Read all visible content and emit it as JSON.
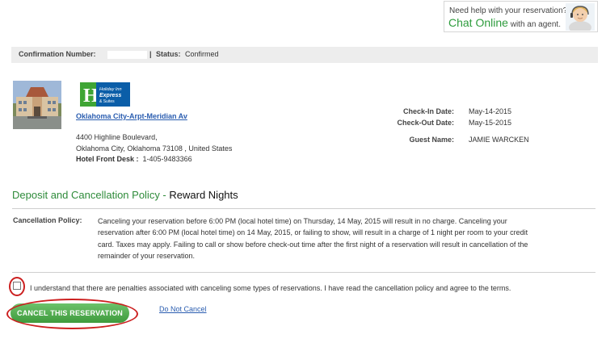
{
  "chat": {
    "line1": "Need help with your reservation?",
    "big": "Chat Online",
    "small": " with an agent.",
    "avatar_icon": "support-agent-avatar-icon"
  },
  "confirmation": {
    "number_label": "Confirmation Number:",
    "number_value": "",
    "status_label": "Status:",
    "status_value": "Confirmed"
  },
  "hotel": {
    "name_link": "Oklahoma City-Arpt-Meridian Av",
    "address1": "4400 Highline Boulevard,",
    "address2": "Oklahoma City, Oklahoma  73108 , United States",
    "front_desk_label": "Hotel Front Desk :",
    "front_desk_phone": "1-405-9483366",
    "logo_text": [
      "Holiday Inn",
      "Express",
      "& Suites"
    ]
  },
  "stay": {
    "check_in_label": "Check-In Date:",
    "check_in_value": "May-14-2015",
    "check_out_label": "Check-Out Date:",
    "check_out_value": "May-15-2015",
    "guest_label": "Guest Name:",
    "guest_value": "JAMIE WARCKEN"
  },
  "policy": {
    "title": "Deposit and Cancellation Policy - ",
    "title_suffix": " Reward Nights",
    "label": "Cancellation Policy:",
    "text": "Canceling your reservation before 6:00 PM (local hotel time) on Thursday, 14 May, 2015 will result in no charge. Canceling your reservation after 6:00 PM (local hotel time) on 14 May, 2015, or failing to show, will result in a charge of 1 night per room to your credit card. Taxes may apply. Failing to call or show before check-out time after the first night of a reservation will result in cancellation of the remainder of your reservation."
  },
  "agree": {
    "text": "I understand that there are penalties associated with canceling some types of reservations. I have read the cancellation policy and agree to the terms."
  },
  "actions": {
    "cancel_label": "CANCEL THIS RESERVATION",
    "not_cancel_label": "Do Not Cancel"
  },
  "colors": {
    "accent_green": "#2e8b3a",
    "link_blue": "#2a5db0",
    "annotation_red": "#cc2020"
  }
}
